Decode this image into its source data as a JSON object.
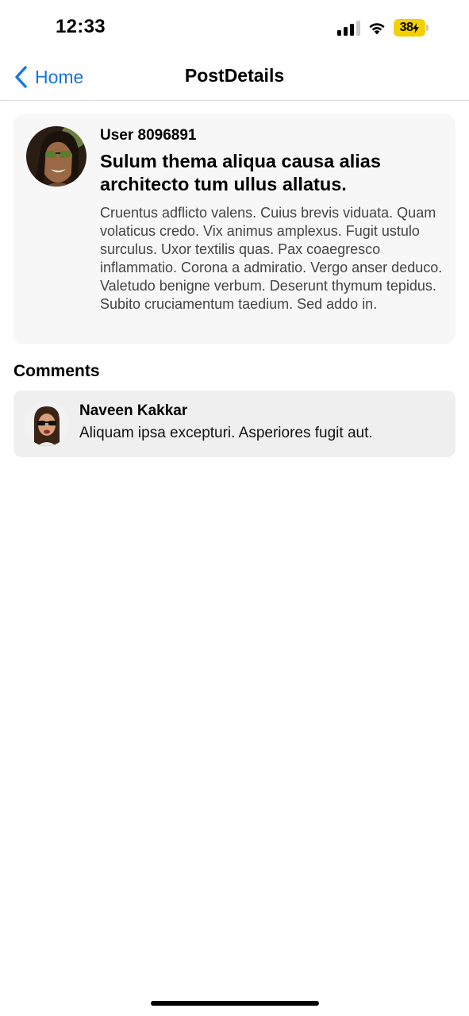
{
  "status_bar": {
    "time": "12:33",
    "battery_level": "38",
    "battery_color": "#f4d000",
    "signal_bars_active": 3,
    "signal_bars_total": 4
  },
  "nav": {
    "back_label": "Home",
    "back_icon": "chevron-left-icon",
    "title": "PostDetails",
    "accent_color": "#1a73e8"
  },
  "post": {
    "user": "User 8096891",
    "title": "Sulum thema aliqua causa alias architecto tum ullus allatus.",
    "body": "Cruentus adflicto valens. Cuius brevis viduata. Quam volaticus credo. Vix animus amplexus. Fugit ustulo surculus. Uxor textilis quas. Pax coaegresco inflammatio. Corona a admiratio. Vergo anser deduco. Valetudo benigne verbum. Deserunt thymum tepidus. Subito cruciamentum taedium. Sed addo in."
  },
  "comments": {
    "heading": "Comments",
    "items": [
      {
        "author": "Naveen Kakkar",
        "text": "Aliquam ipsa excepturi. Asperiores fugit aut."
      }
    ]
  }
}
